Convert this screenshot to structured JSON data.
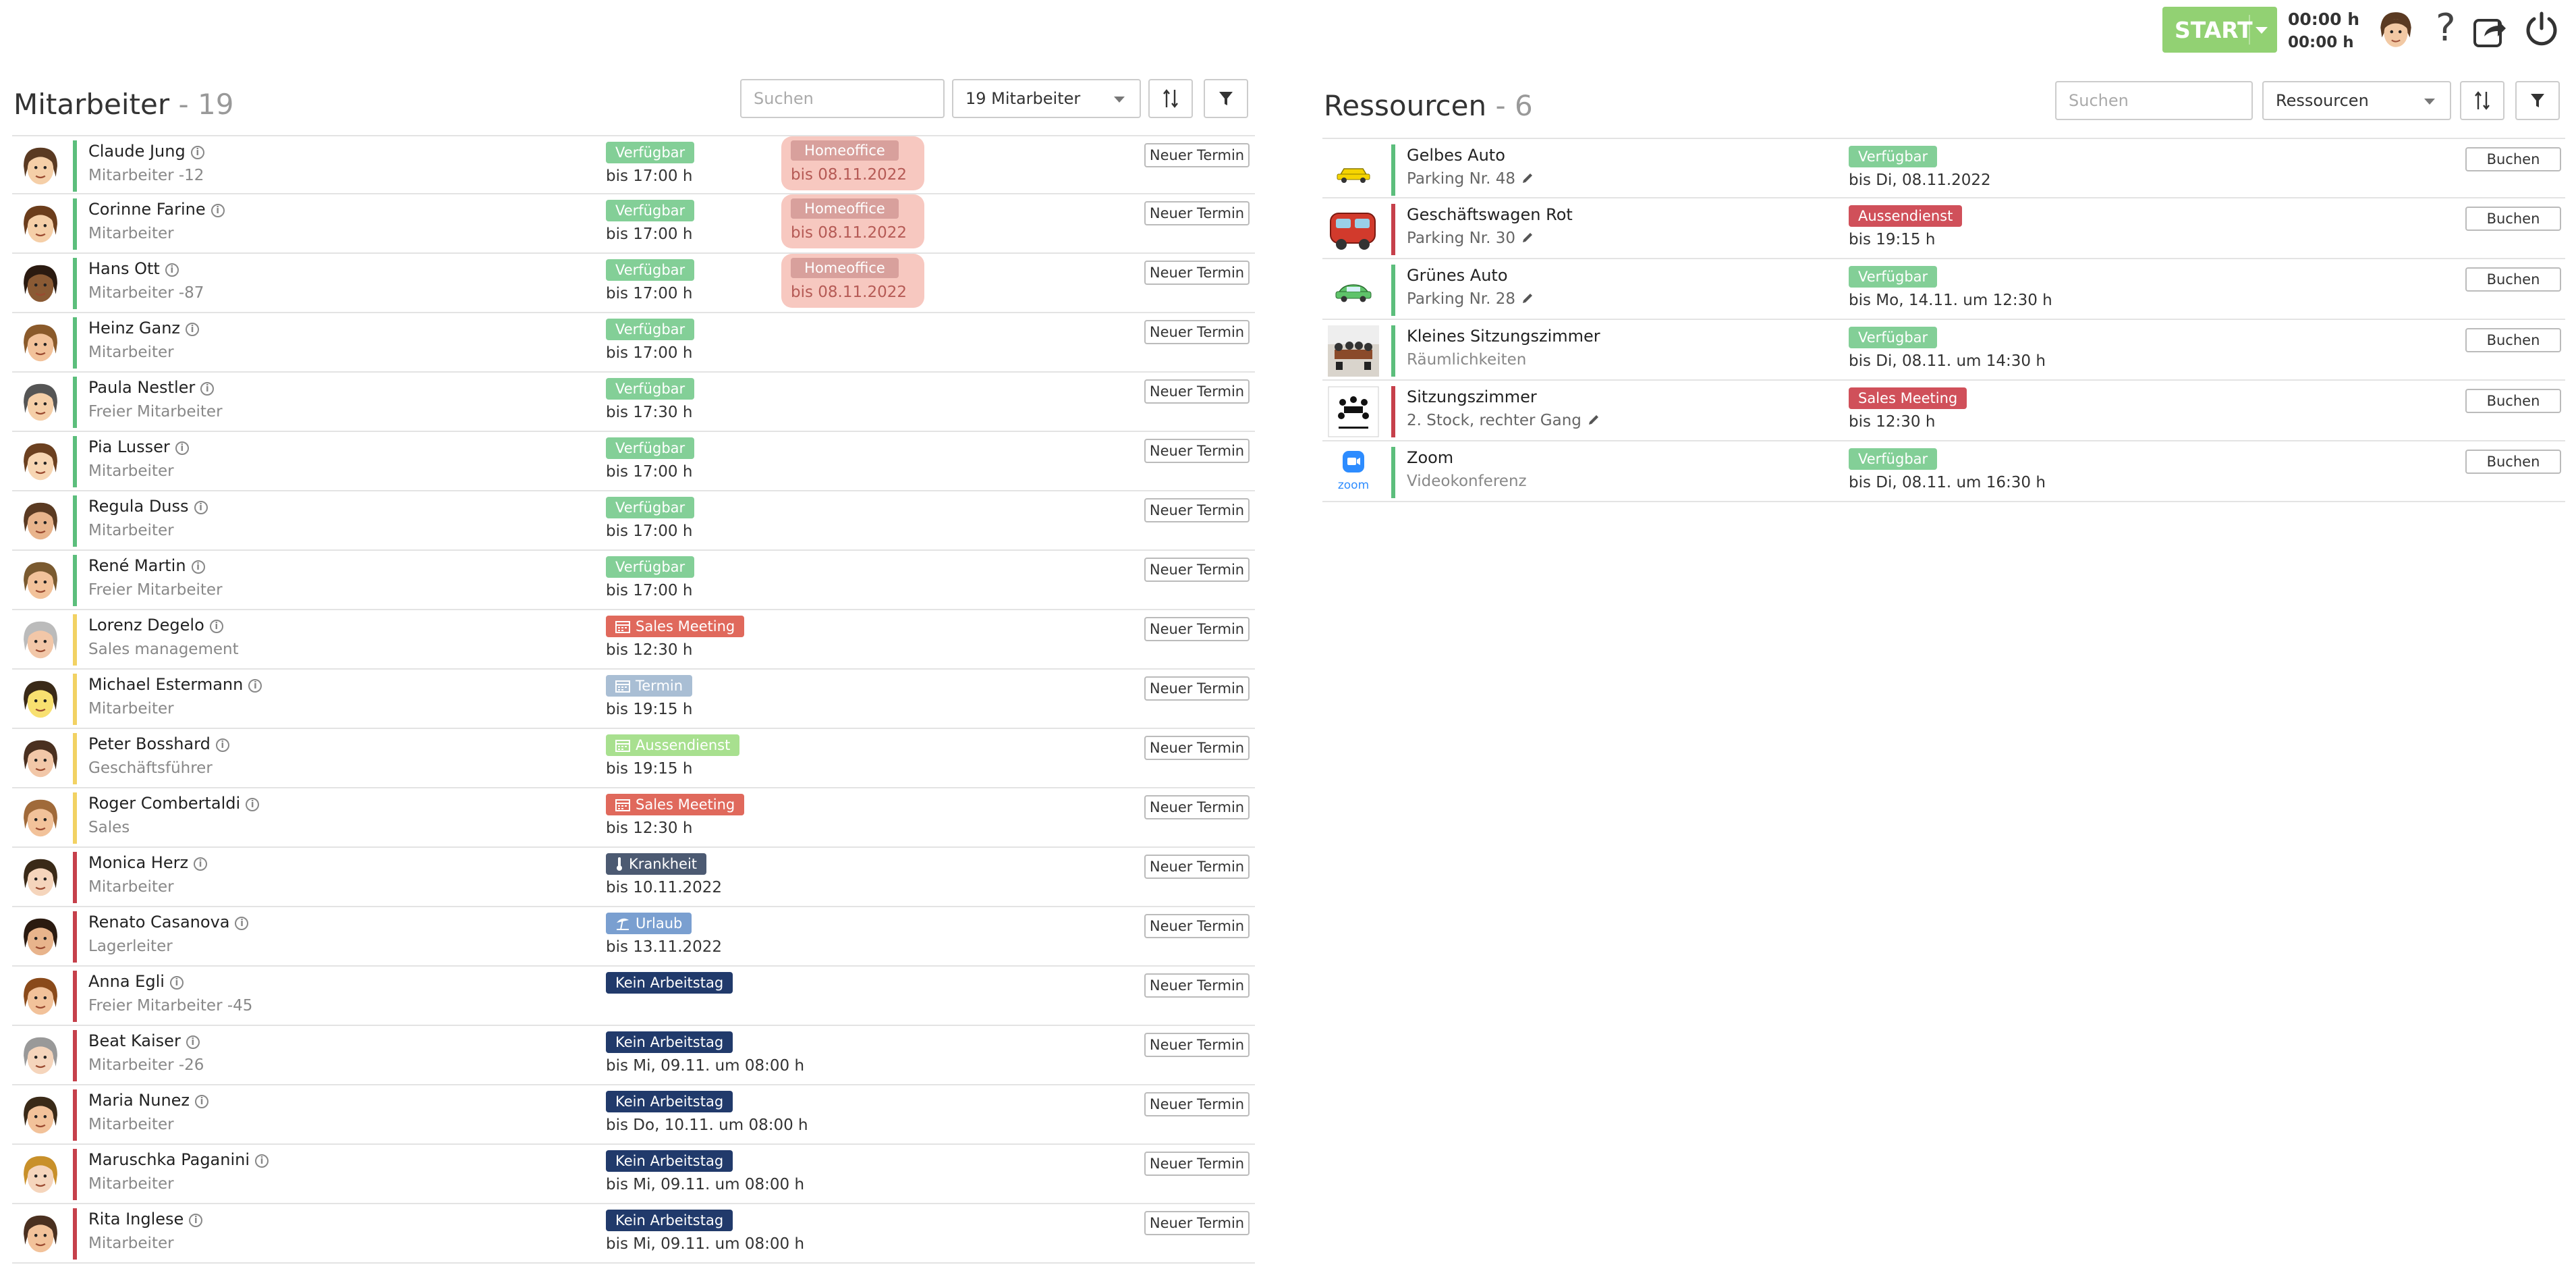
{
  "topbar": {
    "start_label": "START",
    "time_primary": "00:00 h",
    "time_secondary": "00:00 h"
  },
  "colors": {
    "available": "#83cf97",
    "meeting": "#e0695c",
    "termin": "#a9bed4",
    "aussendienst_light": "#a8e08f",
    "krankheit": "#4c5a72",
    "urlaub": "#7a9fd0",
    "kein_arbeitstag": "#213a6b",
    "aussendienst_res": "#d0505a",
    "sales_meeting_res": "#d0505a",
    "bar_green": "#5cbe7c",
    "bar_yellow": "#f2d263",
    "bar_red": "#c6404b",
    "start_green": "#92d173"
  },
  "employees": {
    "title": "Mitarbeiter",
    "count": "- 19",
    "search_placeholder": "Suchen",
    "filter_value": "19 Mitarbeiter",
    "rows": [
      {
        "name": "Claude Jung",
        "role": "Mitarbeiter -12",
        "status": "Verfügbar",
        "until": "bis 17:00 h",
        "ho": "Homeoffice",
        "ho_until": "bis 08.11.2022",
        "btn": "Neuer Termin"
      },
      {
        "name": "Corinne Farine",
        "role": "Mitarbeiter",
        "status": "Verfügbar",
        "until": "bis 17:00 h",
        "ho": "Homeoffice",
        "ho_until": "bis 08.11.2022",
        "btn": "Neuer Termin"
      },
      {
        "name": "Hans Ott",
        "role": "Mitarbeiter -87",
        "status": "Verfügbar",
        "until": "bis 17:00 h",
        "ho": "Homeoffice",
        "ho_until": "bis 08.11.2022",
        "btn": "Neuer Termin"
      },
      {
        "name": "Heinz Ganz",
        "role": "Mitarbeiter",
        "status": "Verfügbar",
        "until": "bis 17:00 h",
        "btn": "Neuer Termin"
      },
      {
        "name": "Paula Nestler",
        "role": "Freier Mitarbeiter",
        "status": "Verfügbar",
        "until": "bis 17:30 h",
        "btn": "Neuer Termin"
      },
      {
        "name": "Pia Lusser",
        "role": "Mitarbeiter",
        "status": "Verfügbar",
        "until": "bis 17:00 h",
        "btn": "Neuer Termin"
      },
      {
        "name": "Regula Duss",
        "role": "Mitarbeiter",
        "status": "Verfügbar",
        "until": "bis 17:00 h",
        "btn": "Neuer Termin"
      },
      {
        "name": "René Martin",
        "role": "Freier Mitarbeiter",
        "status": "Verfügbar",
        "until": "bis 17:00 h",
        "btn": "Neuer Termin"
      },
      {
        "name": "Lorenz Degelo",
        "role": "Sales management",
        "status": "Sales Meeting",
        "until": "bis 12:30 h",
        "btn": "Neuer Termin"
      },
      {
        "name": "Michael Estermann",
        "role": "Mitarbeiter",
        "status": "Termin",
        "until": "bis 19:15 h",
        "btn": "Neuer Termin"
      },
      {
        "name": "Peter Bosshard",
        "role": "Geschäftsführer",
        "status": "Aussendienst",
        "until": "bis 19:15 h",
        "btn": "Neuer Termin"
      },
      {
        "name": "Roger Combertaldi",
        "role": "Sales",
        "status": "Sales Meeting",
        "until": "bis 12:30 h",
        "btn": "Neuer Termin"
      },
      {
        "name": "Monica Herz",
        "role": "Mitarbeiter",
        "status": "Krankheit",
        "until": "bis 10.11.2022",
        "btn": "Neuer Termin"
      },
      {
        "name": "Renato Casanova",
        "role": "Lagerleiter",
        "status": "Urlaub",
        "until": "bis 13.11.2022",
        "btn": "Neuer Termin"
      },
      {
        "name": "Anna Egli",
        "role": "Freier Mitarbeiter -45",
        "status": "Kein Arbeitstag",
        "until": "",
        "btn": "Neuer Termin"
      },
      {
        "name": "Beat Kaiser",
        "role": "Mitarbeiter -26",
        "status": "Kein Arbeitstag",
        "until": "bis Mi, 09.11. um 08:00 h",
        "btn": "Neuer Termin"
      },
      {
        "name": "Maria Nunez",
        "role": "Mitarbeiter",
        "status": "Kein Arbeitstag",
        "until": "bis Do, 10.11. um 08:00 h",
        "btn": "Neuer Termin"
      },
      {
        "name": "Maruschka Paganini",
        "role": "Mitarbeiter",
        "status": "Kein Arbeitstag",
        "until": "bis Mi, 09.11. um 08:00 h",
        "btn": "Neuer Termin"
      },
      {
        "name": "Rita Inglese",
        "role": "Mitarbeiter",
        "status": "Kein Arbeitstag",
        "until": "bis Mi, 09.11. um 08:00 h",
        "btn": "Neuer Termin"
      }
    ]
  },
  "resources": {
    "title": "Ressourcen",
    "count": "- 6",
    "search_placeholder": "Suchen",
    "filter_value": "Ressourcen",
    "rows": [
      {
        "name": "Gelbes Auto",
        "sub": "Parking Nr. 48",
        "status": "Verfügbar",
        "until": "bis Di, 08.11.2022",
        "btn": "Buchen"
      },
      {
        "name": "Geschäftswagen Rot",
        "sub": "Parking Nr. 30",
        "status": "Aussendienst",
        "until": "bis 19:15 h",
        "btn": "Buchen"
      },
      {
        "name": "Grünes Auto",
        "sub": "Parking Nr. 28",
        "status": "Verfügbar",
        "until": "bis Mo, 14.11. um 12:30 h",
        "btn": "Buchen"
      },
      {
        "name": "Kleines Sitzungszimmer",
        "sub": "Räumlichkeiten",
        "status": "Verfügbar",
        "until": "bis Di, 08.11. um 14:30 h",
        "btn": "Buchen"
      },
      {
        "name": "Sitzungszimmer",
        "sub": "2. Stock, rechter Gang",
        "status": "Sales Meeting",
        "until": "bis 12:30 h",
        "btn": "Buchen"
      },
      {
        "name": "Zoom",
        "sub": "Videokonferenz",
        "status": "Verfügbar",
        "until": "bis Di, 08.11. um 16:30 h",
        "btn": "Buchen"
      }
    ],
    "zoom_logo_text": "zoom"
  }
}
